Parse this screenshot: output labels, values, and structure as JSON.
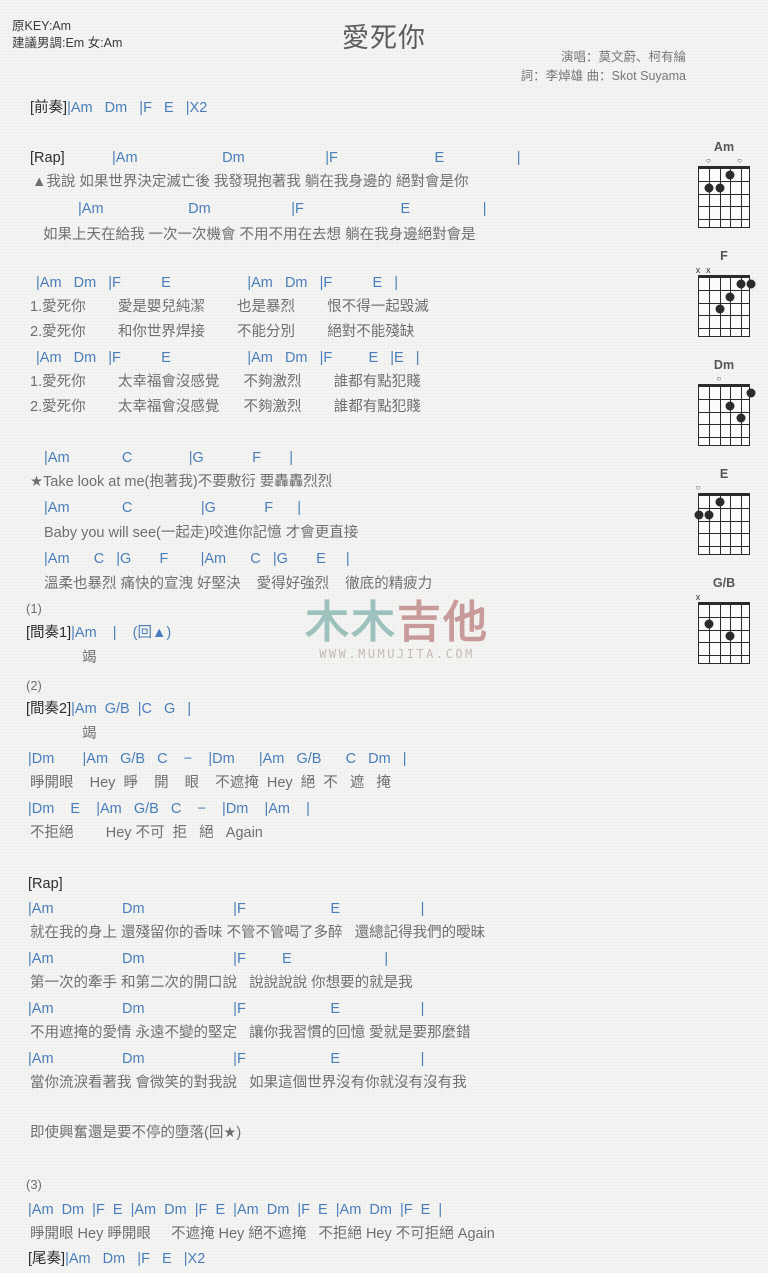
{
  "header": {
    "key_line": "原KEY:Am",
    "suggest_line": "建議男調:Em 女:Am",
    "title": "愛死你",
    "singer_line": "演唱：莫文蔚、柯有綸",
    "writer_line": "詞：李焯雄   曲：Skot Suyama"
  },
  "watermark": {
    "char1": "木木",
    "char2": "吉他",
    "url": "WWW.MUMUJITA.COM"
  },
  "sections": {
    "intro": {
      "tag": "[前奏]",
      "chords": "|Am   Dm   |F   E   |X2"
    },
    "rap1": {
      "tag": "[Rap]"
    },
    "rap2": {
      "tag": "[Rap]"
    },
    "interlude1": {
      "num": "(1)",
      "tag": "[間奏1]",
      "chords": "|Am    |    (回▲)",
      "lyric": "竭"
    },
    "interlude2": {
      "num": "(2)",
      "tag": "[間奏2]",
      "chords": "|Am  G/B  |C   G   |",
      "lyric": "竭"
    },
    "ending": {
      "tag": "[尾奏]",
      "chords": "|Am   Dm   |F   E   |X2"
    },
    "outro_num": "(3)"
  },
  "lines": [
    {
      "id": "rap1-c1",
      "chords": "|Am                     Dm                    |F                        E                  |"
    },
    {
      "id": "rap1-l1",
      "lyric": "▲我說 如果世界決定滅亡後 我發現抱著我 躺在我身邊的 絕對會是你"
    },
    {
      "id": "rap1-c2",
      "chords": "|Am                     Dm                    |F                        E                  |"
    },
    {
      "id": "rap1-l2",
      "lyric": "如果上天在給我 一次一次機會 不用不用在去想 躺在我身邊絕對會是"
    },
    {
      "id": "v1-c1",
      "chords": "|Am   Dm   |F          E                   |Am   Dm   |F          E   |"
    },
    {
      "id": "v1-l1",
      "lyric": "1.愛死你        愛是嬰兒純潔        也是暴烈        恨不得一起毀滅"
    },
    {
      "id": "v1-l2",
      "lyric": "2.愛死你        和你世界焊接        不能分別        絕對不能殘缺"
    },
    {
      "id": "v2-c1",
      "chords": "|Am   Dm   |F          E                   |Am   Dm   |F         E   |E   |"
    },
    {
      "id": "v2-l1",
      "lyric": "1.愛死你        太幸福會沒感覺      不夠激烈        誰都有點犯賤"
    },
    {
      "id": "v2-l2",
      "lyric": "2.愛死你        太幸福會沒感覺      不夠激烈        誰都有點犯賤"
    },
    {
      "id": "ch-c1",
      "chords": "|Am             C              |G            F       |"
    },
    {
      "id": "ch-l1",
      "lyric": "★Take look at me(抱著我)不要敷衍 要轟轟烈烈"
    },
    {
      "id": "ch-c2",
      "chords": "|Am             C                 |G            F      |"
    },
    {
      "id": "ch-l2",
      "lyric": "Baby you will see(一起走)咬進你記憶 才會更直接"
    },
    {
      "id": "ch-c3",
      "chords": "|Am      C   |G       F        |Am      C   |G       E     |"
    },
    {
      "id": "ch-l3",
      "lyric": "溫柔也暴烈 痛快的宣洩 好堅決    愛得好強烈    徹底的精疲力"
    },
    {
      "id": "b-c1",
      "chords": "|Dm       |Am   G/B   C    −    |Dm      |Am   G/B      C   Dm   |"
    },
    {
      "id": "b-l1",
      "lyric": "睜開眼    Hey  睜    開    眼    不遮掩  Hey  絕  不   遮   掩"
    },
    {
      "id": "b-c2",
      "chords": "|Dm    E    |Am   G/B   C    −    |Dm    |Am    |"
    },
    {
      "id": "b-l2",
      "lyric": "不拒絕        Hey 不可  拒   絕   Again"
    },
    {
      "id": "rap2-c1",
      "chords": "|Am                 Dm                      |F                     E                    |"
    },
    {
      "id": "rap2-l1",
      "lyric": "就在我的身上 還殘留你的香味 不管不管喝了多醉   還總記得我們的曖昧"
    },
    {
      "id": "rap2-c2",
      "chords": "|Am                 Dm                      |F         E                       |"
    },
    {
      "id": "rap2-l2",
      "lyric": "第一次的牽手 和第二次的開口說   說說說說 你想要的就是我"
    },
    {
      "id": "rap2-c3",
      "chords": "|Am                 Dm                      |F                     E                    |"
    },
    {
      "id": "rap2-l3",
      "lyric": "不用遮掩的愛情 永遠不變的堅定   讓你我習慣的回憶 愛就是要那麼錯"
    },
    {
      "id": "rap2-c4",
      "chords": "|Am                 Dm                      |F                     E                    |"
    },
    {
      "id": "rap2-l4",
      "lyric": "當你流淚看著我 會微笑的對我說   如果這個世界沒有你就沒有沒有我"
    },
    {
      "id": "rap2-l5",
      "lyric": "即使興奮還是要不停的墮落(回★)"
    },
    {
      "id": "out-c1",
      "chords": "|Am  Dm  |F  E  |Am  Dm  |F  E  |Am  Dm  |F  E  |Am  Dm  |F  E  |"
    },
    {
      "id": "out-l1",
      "lyric": "睜開眼 Hey 睜開眼     不遮掩 Hey 絕不遮掩   不拒絕 Hey 不可拒絕 Again"
    }
  ],
  "chord_diagrams": [
    {
      "name": "Am",
      "markers": [
        {
          "x": 1,
          "sym": "○"
        },
        {
          "x": 4,
          "sym": "○"
        }
      ],
      "dots": [
        {
          "s": 3,
          "f": 1
        },
        {
          "s": 1,
          "f": 2
        },
        {
          "s": 2,
          "f": 2
        }
      ],
      "nut": true
    },
    {
      "name": "F",
      "markers": [
        {
          "x": 0,
          "sym": "x"
        },
        {
          "x": 1,
          "sym": "x"
        }
      ],
      "dots": [
        {
          "s": 4,
          "f": 1
        },
        {
          "s": 5,
          "f": 1
        },
        {
          "s": 3,
          "f": 2
        },
        {
          "s": 2,
          "f": 3
        }
      ],
      "nut": true
    },
    {
      "name": "Dm",
      "markers": [
        {
          "x": 2,
          "sym": "○"
        }
      ],
      "dots": [
        {
          "s": 5,
          "f": 1
        },
        {
          "s": 3,
          "f": 2
        },
        {
          "s": 4,
          "f": 3
        }
      ],
      "nut": true
    },
    {
      "name": "E",
      "markers": [
        {
          "x": 0,
          "sym": "○"
        }
      ],
      "dots": [
        {
          "s": 2,
          "f": 1
        },
        {
          "s": 0,
          "f": 2
        },
        {
          "s": 1,
          "f": 2
        }
      ],
      "nut": true
    },
    {
      "name": "G/B",
      "markers": [
        {
          "x": 0,
          "sym": "x"
        }
      ],
      "dots": [
        {
          "s": 1,
          "f": 2
        },
        {
          "s": 3,
          "f": 3
        }
      ],
      "nut": true
    }
  ]
}
